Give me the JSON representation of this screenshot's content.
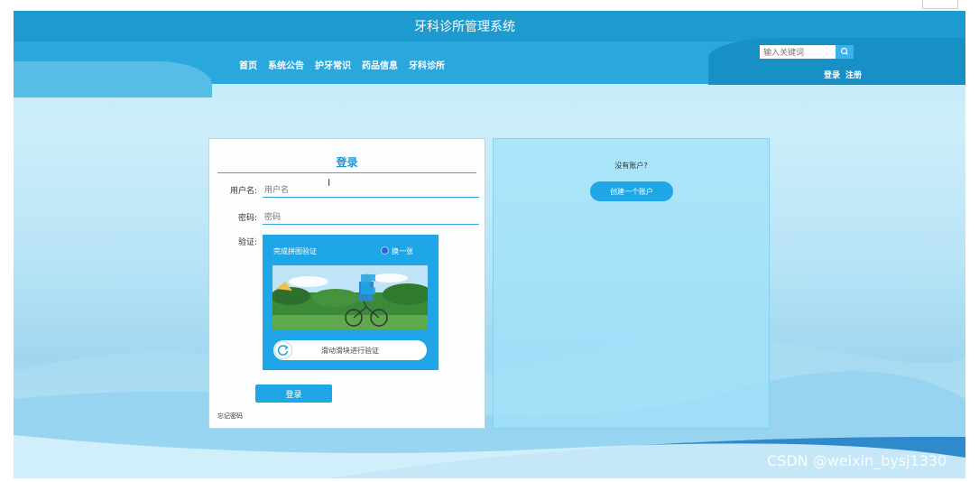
{
  "header": {
    "title": "牙科诊所管理系统",
    "nav": [
      "首页",
      "系统公告",
      "护牙常识",
      "药品信息",
      "牙科诊所"
    ],
    "search_placeholder": "输入关键词",
    "login_link": "登录",
    "register_link": "注册"
  },
  "login": {
    "title": "登录",
    "username_label": "用户名:",
    "username_placeholder": "用户名",
    "password_label": "密码:",
    "password_placeholder": "密码",
    "captcha_label": "验证:",
    "captcha_tip": "完成拼图验证",
    "captcha_refresh": "换一张",
    "slider_text": "滑动滑块进行验证",
    "submit": "登录",
    "forgot": "忘记密码"
  },
  "register": {
    "question": "没有账户?",
    "create_button": "创建一个账户"
  },
  "watermark": "CSDN @weixin_bysj1330"
}
